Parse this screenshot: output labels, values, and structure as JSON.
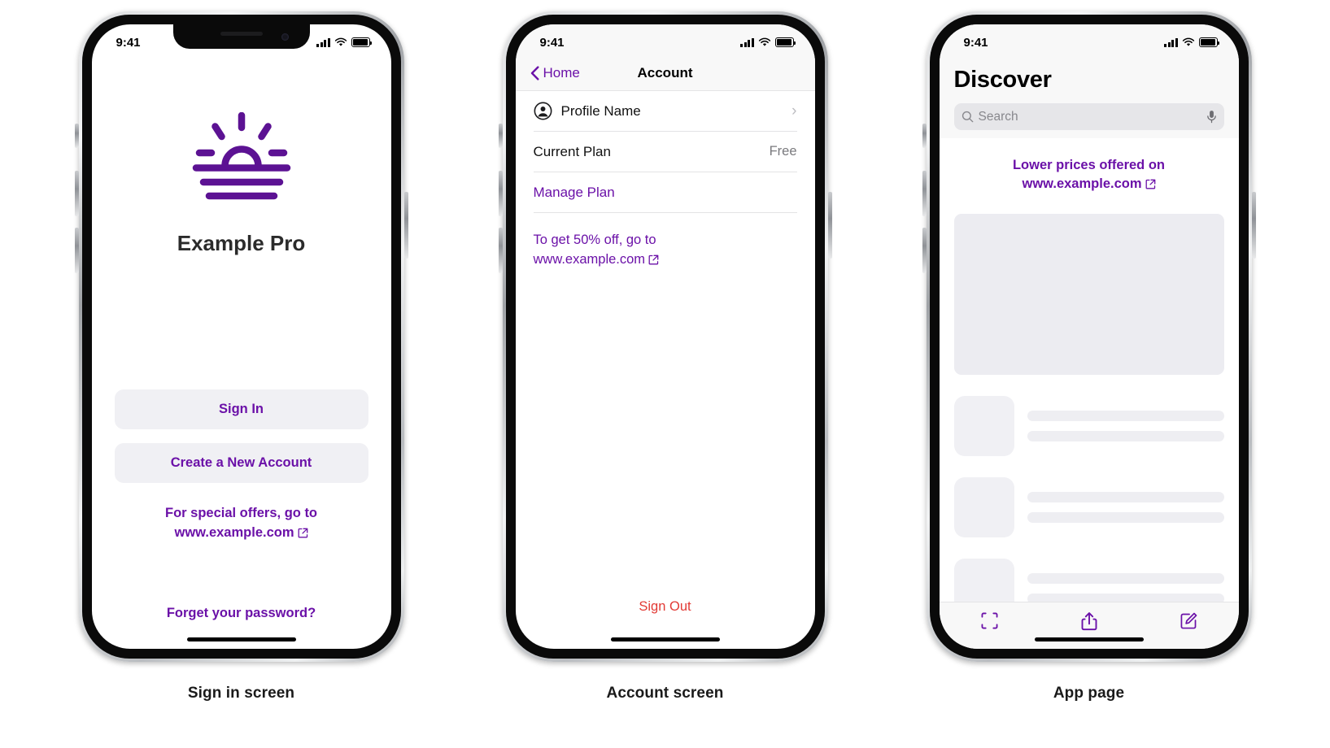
{
  "accent_color": "#6b11a8",
  "destructive_color": "#e23a35",
  "status_bar": {
    "time": "9:41",
    "cellular_icon": "signal-bars-icon",
    "wifi_icon": "wifi-icon",
    "battery_icon": "battery-full-icon"
  },
  "screens": [
    {
      "caption": "Sign in screen",
      "logo_icon": "sunrise-icon",
      "app_title": "Example Pro",
      "primary_button": "Sign In",
      "secondary_button": "Create a New Account",
      "offer_line1": "For special offers, go to",
      "offer_link": "www.example.com",
      "external_link_icon": "external-link-icon",
      "forgot_password": "Forget your password?"
    },
    {
      "caption": "Account screen",
      "nav": {
        "back_label": "Home",
        "back_icon": "chevron-left-icon",
        "title": "Account"
      },
      "rows": [
        {
          "label": "Profile Name",
          "value": "",
          "icon": "person-circle-icon",
          "accessory": "chevron-right-icon",
          "style": "default"
        },
        {
          "label": "Current Plan",
          "value": "Free",
          "icon": "",
          "accessory": "",
          "style": "default"
        },
        {
          "label": "Manage Plan",
          "value": "",
          "icon": "",
          "accessory": "",
          "style": "link"
        }
      ],
      "promo_line1": "To get 50% off, go to",
      "promo_link": "www.example.com",
      "external_link_icon": "external-link-icon",
      "sign_out": "Sign Out"
    },
    {
      "caption": "App page",
      "title": "Discover",
      "search": {
        "placeholder": "Search",
        "search_icon": "search-icon",
        "mic_icon": "microphone-icon"
      },
      "promo_line1": "Lower prices offered on",
      "promo_link": "www.example.com",
      "external_link_icon": "external-link-icon",
      "hero_placeholder": "content-placeholder-card",
      "skeleton_rows": 3,
      "toolbar": [
        {
          "name": "scan-icon",
          "label": "Scan"
        },
        {
          "name": "share-icon",
          "label": "Share"
        },
        {
          "name": "compose-icon",
          "label": "Compose"
        }
      ]
    }
  ]
}
